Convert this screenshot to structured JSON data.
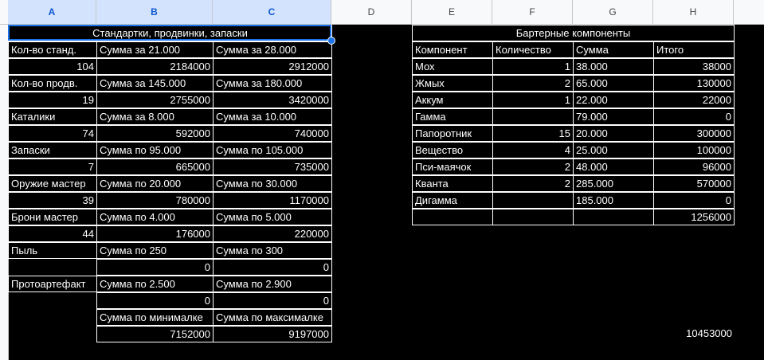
{
  "columns": [
    "A",
    "B",
    "C",
    "D",
    "E",
    "F",
    "G",
    "H"
  ],
  "left_table": {
    "title": "Стандартки, продвинки, запаски",
    "rows": [
      [
        "Кол-во станд.",
        "Сумма за 21.000",
        "Сумма за 28.000"
      ],
      [
        "104",
        "2184000",
        "2912000"
      ],
      [
        "Кол-во продв.",
        "Сумма за 145.000",
        "Сумма за 180.000"
      ],
      [
        "19",
        "2755000",
        "3420000"
      ],
      [
        "Каталики",
        "Сумма за 8.000",
        "Сумма за 10.000"
      ],
      [
        "74",
        "592000",
        "740000"
      ],
      [
        "Запаски",
        "Сумма по 95.000",
        "Сумма по 105.000"
      ],
      [
        "7",
        "665000",
        "735000"
      ],
      [
        "Оружие мастер",
        "Сумма по 20.000",
        "Сумма по 30.000"
      ],
      [
        "39",
        "780000",
        "1170000"
      ],
      [
        "Брони мастер",
        "Сумма по 4.000",
        "Сумма по 5.000"
      ],
      [
        "44",
        "176000",
        "220000"
      ],
      [
        "Пыль",
        "Сумма по 250",
        "Сумма по 300"
      ],
      [
        "",
        "0",
        "0"
      ],
      [
        "Протоартефакт",
        "Сумма по 2.500",
        "Сумма по 2.900"
      ],
      [
        "",
        "0",
        "0"
      ],
      [
        "",
        "Сумма по минималке",
        "Сумма по максималке"
      ],
      [
        "",
        "7152000",
        "9197000"
      ]
    ]
  },
  "right_table": {
    "title": "Бартерные компоненты",
    "headers": [
      "Компонент",
      "Количество",
      "Сумма",
      "Итого"
    ],
    "rows": [
      [
        "Мох",
        "1",
        "38.000",
        "38000"
      ],
      [
        "Жмых",
        "2",
        "65.000",
        "130000"
      ],
      [
        "Аккум",
        "1",
        "22.000",
        "22000"
      ],
      [
        "Гамма",
        "",
        "79.000",
        "0"
      ],
      [
        "Папоротник",
        "15",
        "20.000",
        "300000"
      ],
      [
        "Вещество",
        "4",
        "25.000",
        "100000"
      ],
      [
        "Пси-маячок",
        "2",
        "48.000",
        "96000"
      ],
      [
        "Кванта",
        "2",
        "285.000",
        "570000"
      ],
      [
        "Дигамма",
        "",
        "185.000",
        "0"
      ],
      [
        "",
        "",
        "",
        "1256000"
      ]
    ]
  },
  "grand_total": "10453000"
}
